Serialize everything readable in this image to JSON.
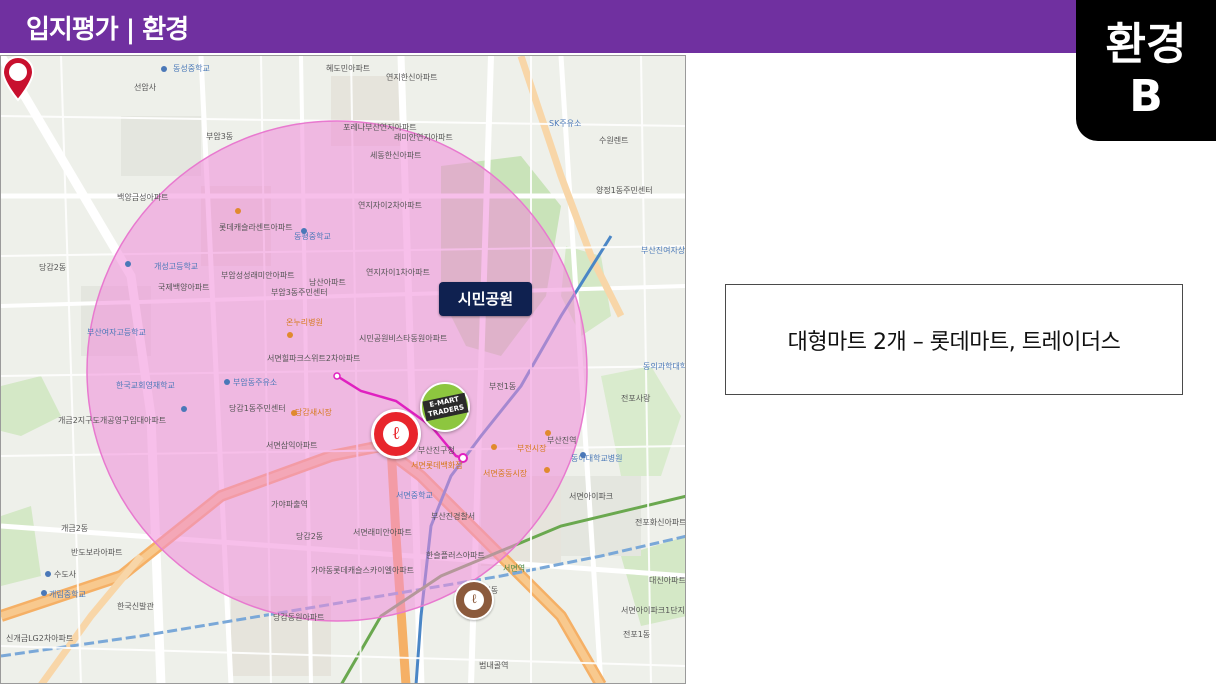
{
  "header": {
    "title": "입지평가 | 환경",
    "bar_color": "#7030a0"
  },
  "grade_badge": {
    "category": "환경",
    "grade": "B"
  },
  "map": {
    "park_label": "시민공원",
    "markers": [
      {
        "name": "lotte-mart",
        "icon": "lotte-mart-icon",
        "color": "#e8252c"
      },
      {
        "name": "emart-traders",
        "icon": "emart-traders-icon",
        "color": "#8dc63f",
        "line1": "E-MART",
        "line2": "TRADERS"
      },
      {
        "name": "lotte-department",
        "icon": "lotte-department-icon",
        "color": "#8b5a3c"
      },
      {
        "name": "site-pin",
        "icon": "map-pin-icon",
        "color": "#c8102e"
      }
    ],
    "radius_overlay_color": "#f08ad8",
    "labels": [
      {
        "text": "동성중학교",
        "cls": "blue"
      },
      {
        "text": "선암사",
        "cls": ""
      },
      {
        "text": "부암3동",
        "cls": ""
      },
      {
        "text": "백양금성아파트",
        "cls": ""
      },
      {
        "text": "당감2동",
        "cls": ""
      },
      {
        "text": "개성고등학교",
        "cls": "blue"
      },
      {
        "text": "국제백양아파트",
        "cls": ""
      },
      {
        "text": "부산여자고등학교",
        "cls": "blue"
      },
      {
        "text": "한국교회영재학교",
        "cls": "blue"
      },
      {
        "text": "개금2지구도개공영구임대아파트",
        "cls": ""
      },
      {
        "text": "개금2동",
        "cls": ""
      },
      {
        "text": "반도보라아파트",
        "cls": ""
      },
      {
        "text": "수도사",
        "cls": ""
      },
      {
        "text": "개림중학교",
        "cls": "blue"
      },
      {
        "text": "한국신발관",
        "cls": ""
      },
      {
        "text": "신개금LG2차아파트",
        "cls": ""
      },
      {
        "text": "동평중학교",
        "cls": "blue"
      },
      {
        "text": "롯데캐슬라센트아파트",
        "cls": ""
      },
      {
        "text": "부암성성래미안아파트",
        "cls": ""
      },
      {
        "text": "부암3동주민센터",
        "cls": ""
      },
      {
        "text": "온누리병원",
        "cls": "orange"
      },
      {
        "text": "부암동주유소",
        "cls": "blue"
      },
      {
        "text": "당감1동주민센터",
        "cls": ""
      },
      {
        "text": "당감새시장",
        "cls": "orange"
      },
      {
        "text": "서면삼익아파트",
        "cls": ""
      },
      {
        "text": "가야파출역",
        "cls": ""
      },
      {
        "text": "당감2동",
        "cls": ""
      },
      {
        "text": "가야동롯데캐슬스카이엘아파트",
        "cls": ""
      },
      {
        "text": "서면래미안아파트",
        "cls": ""
      },
      {
        "text": "당감동원아파트",
        "cls": ""
      },
      {
        "text": "혜도민아파트",
        "cls": ""
      },
      {
        "text": "연지한신아파트",
        "cls": ""
      },
      {
        "text": "포레나부산연지아파트",
        "cls": ""
      },
      {
        "text": "래미안연지아파트",
        "cls": ""
      },
      {
        "text": "세동한신아파트",
        "cls": ""
      },
      {
        "text": "연지자이2차아파트",
        "cls": ""
      },
      {
        "text": "연지자이1차아파트",
        "cls": ""
      },
      {
        "text": "남산아파트",
        "cls": ""
      },
      {
        "text": "시민공원비스타동원아파트",
        "cls": ""
      },
      {
        "text": "서면힐파크스위트2차아파트",
        "cls": ""
      },
      {
        "text": "부산진구청",
        "cls": ""
      },
      {
        "text": "서면중학교",
        "cls": "blue"
      },
      {
        "text": "한슬플러스아파트",
        "cls": ""
      },
      {
        "text": "부산진경찰서",
        "cls": ""
      },
      {
        "text": "서면역",
        "cls": "green"
      },
      {
        "text": "범천동",
        "cls": ""
      },
      {
        "text": "범내골역",
        "cls": ""
      },
      {
        "text": "SK주유소",
        "cls": "blue"
      },
      {
        "text": "수원렌트",
        "cls": ""
      },
      {
        "text": "양정1동주민센터",
        "cls": ""
      },
      {
        "text": "부산진여자상업고등학교",
        "cls": "blue"
      },
      {
        "text": "동의과학대학교",
        "cls": "blue"
      },
      {
        "text": "서면롯데백화점",
        "cls": "orange"
      },
      {
        "text": "서면중동시장",
        "cls": "orange"
      },
      {
        "text": "부전1동",
        "cls": ""
      },
      {
        "text": "부전시장",
        "cls": "orange"
      },
      {
        "text": "서면아이파크",
        "cls": ""
      },
      {
        "text": "전포사랑",
        "cls": ""
      },
      {
        "text": "부산진역",
        "cls": ""
      },
      {
        "text": "전포1동",
        "cls": ""
      },
      {
        "text": "대신아파트",
        "cls": ""
      },
      {
        "text": "서면아이파크1단지아파트",
        "cls": ""
      },
      {
        "text": "전포화신아파트",
        "cls": ""
      },
      {
        "text": "동아대학교병원",
        "cls": "blue"
      }
    ]
  },
  "info_box": {
    "text": "대형마트 2개 – 롯데마트, 트레이더스"
  }
}
